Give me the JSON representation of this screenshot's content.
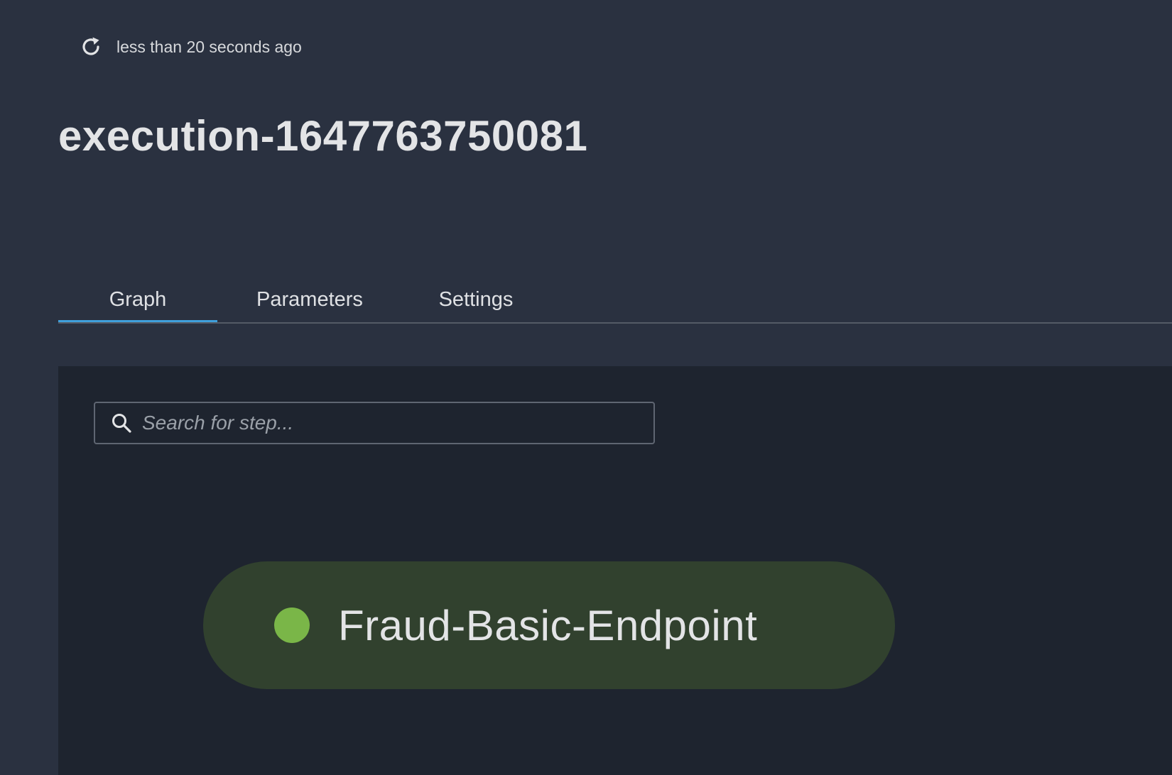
{
  "header": {
    "refresh_icon": "refresh-icon",
    "last_updated": "less than 20 seconds ago",
    "title": "execution-1647763750081"
  },
  "tabs": [
    {
      "label": "Graph",
      "active": true
    },
    {
      "label": "Parameters",
      "active": false
    },
    {
      "label": "Settings",
      "active": false
    }
  ],
  "graph": {
    "search": {
      "icon": "search-icon",
      "placeholder": "Search for step...",
      "value": ""
    },
    "steps": [
      {
        "label": "Fraud-Basic-Endpoint",
        "status_color": "#7ab648",
        "node_color": "#31412e"
      }
    ]
  },
  "colors": {
    "page_background": "#2a3140",
    "panel_background": "#1e242f",
    "active_tab_underline": "#3f9fdb"
  }
}
